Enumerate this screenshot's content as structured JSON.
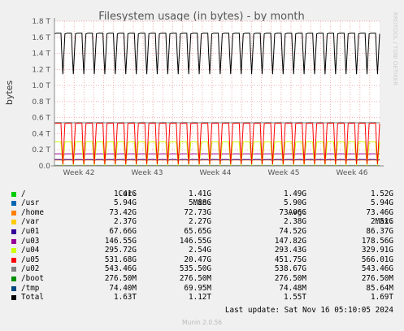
{
  "chart_data": {
    "type": "line",
    "title": "Filesystem usage (in bytes) - by month",
    "ylabel": "bytes",
    "side_label": "RRDTOOL / TOBI OETIKER",
    "ylim": [
      0,
      1.8
    ],
    "yticks": [
      "0.0",
      "0.2 T",
      "0.4 T",
      "0.6 T",
      "0.8 T",
      "1.0 T",
      "1.2 T",
      "1.4 T",
      "1.6 T",
      "1.8 T"
    ],
    "xticks": [
      "Week 42",
      "Week 43",
      "Week 44",
      "Week 45",
      "Week 46"
    ],
    "cycles": 31,
    "series": [
      {
        "name": "/",
        "color": "#00cc00",
        "cur": "1.41G",
        "min": "1.41G",
        "avg": "1.49G",
        "max": "1.52G",
        "hi": 0.0015,
        "lo": 0.0014
      },
      {
        "name": "/usr",
        "color": "#0066b3",
        "cur": "5.94G",
        "min": "5.88G",
        "avg": "5.90G",
        "max": "5.94G",
        "hi": 0.0059,
        "lo": 0.0059
      },
      {
        "name": "/home",
        "color": "#ff8000",
        "cur": "73.42G",
        "min": "72.73G",
        "avg": "73.06G",
        "max": "73.46G",
        "hi": 0.0734,
        "lo": 0.0727
      },
      {
        "name": "/var",
        "color": "#ffcc00",
        "cur": "2.37G",
        "min": "2.27G",
        "avg": "2.38G",
        "max": "2.51G",
        "hi": 0.0025,
        "lo": 0.0023
      },
      {
        "name": "/u01",
        "color": "#330099",
        "cur": "67.66G",
        "min": "65.65G",
        "avg": "74.52G",
        "max": "86.37G",
        "hi": 0.08,
        "lo": 0.066
      },
      {
        "name": "/u03",
        "color": "#990099",
        "cur": "146.55G",
        "min": "146.55G",
        "avg": "147.82G",
        "max": "178.56G",
        "hi": 0.15,
        "lo": 0.1466
      },
      {
        "name": "/u04",
        "color": "#ccff00",
        "cur": "295.72G",
        "min": "2.54G",
        "avg": "293.43G",
        "max": "329.91G",
        "hi": 0.3,
        "lo": 0.0025
      },
      {
        "name": "/u05",
        "color": "#ff0000",
        "cur": "531.68G",
        "min": "20.47G",
        "avg": "451.75G",
        "max": "566.01G",
        "hi": 0.53,
        "lo": 0.02
      },
      {
        "name": "/u02",
        "color": "#808080",
        "cur": "543.46G",
        "min": "535.50G",
        "avg": "538.67G",
        "max": "543.46G",
        "hi": 0.54,
        "lo": 0.535
      },
      {
        "name": "/boot",
        "color": "#008f00",
        "cur": "276.50M",
        "min": "276.50M",
        "avg": "276.50M",
        "max": "276.50M",
        "hi": 0.0003,
        "lo": 0.0003
      },
      {
        "name": "/tmp",
        "color": "#00487d",
        "cur": "74.40M",
        "min": "69.95M",
        "avg": "74.48M",
        "max": "85.64M",
        "hi": 0.0001,
        "lo": 0.0001
      },
      {
        "name": "Total",
        "color": "#000000",
        "cur": "1.63T",
        "min": "1.12T",
        "avg": "1.55T",
        "max": "1.69T",
        "hi": 1.65,
        "lo": 1.14
      }
    ]
  },
  "legend_header": {
    "cur": "Cur:",
    "min": "Min:",
    "avg": "Avg:",
    "max": "Max:"
  },
  "last_update": "Last update: Sat Nov 16 05:10:05 2024",
  "footer_brand": "Munin 2.0.56"
}
